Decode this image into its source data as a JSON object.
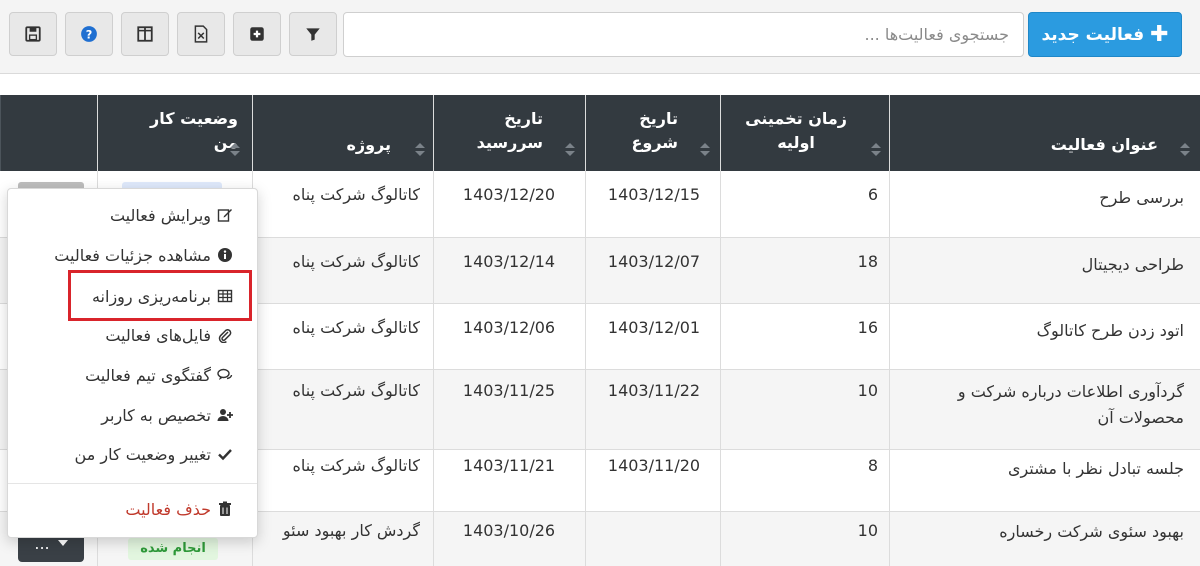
{
  "toolbar": {
    "new_activity_label": "فعالیت جدید",
    "search_placeholder": "جستجوی فعالیت‌ها ..."
  },
  "table": {
    "columns": {
      "title": "عنوان فعالیت",
      "estimate_line1": "زمان تخمینی",
      "estimate_line2": "اولیه",
      "start_line1": "تاریخ",
      "start_line2": "شروع",
      "due_line1": "تاریخ",
      "due_line2": "سررسید",
      "project": "پروژه",
      "status_line1": "وضعیت کار",
      "status_line2": "من"
    },
    "rows": [
      {
        "title": "بررسی طرح",
        "estimate": "6",
        "start": "1403/12/15",
        "due": "1403/12/20",
        "project": "کاتالوگ شرکت پناه"
      },
      {
        "title": "طراحی دیجیتال",
        "estimate": "18",
        "start": "1403/12/07",
        "due": "1403/12/14",
        "project": "کاتالوگ شرکت پناه"
      },
      {
        "title": "اتود زدن طرح کاتالوگ",
        "estimate": "16",
        "start": "1403/12/01",
        "due": "1403/12/06",
        "project": "کاتالوگ شرکت پناه"
      },
      {
        "title": "گردآوری اطلاعات درباره شرکت و محصولات آن",
        "estimate": "10",
        "start": "1403/11/22",
        "due": "1403/11/25",
        "project": "کاتالوگ شرکت پناه"
      },
      {
        "title": "جلسه تبادل نظر با مشتری",
        "estimate": "8",
        "start": "1403/11/20",
        "due": "1403/11/21",
        "project": "کاتالوگ شرکت پناه"
      },
      {
        "title": "بهبود سئوی شرکت رخساره",
        "estimate": "10",
        "start": "",
        "due": "1403/10/26",
        "project": "گردش کار بهبود سئو",
        "status": "انجام شده"
      }
    ]
  },
  "row_menu_button": "...",
  "context_menu": {
    "items": [
      {
        "label": "ویرایش فعالیت",
        "icon": "edit-icon"
      },
      {
        "label": "مشاهده جزئیات فعالیت",
        "icon": "info-icon"
      },
      {
        "label": "برنامه‌ریزی روزانه",
        "icon": "table-icon"
      },
      {
        "label": "فایل‌های فعالیت",
        "icon": "paperclip-icon"
      },
      {
        "label": "گفتگوی تیم فعالیت",
        "icon": "comments-icon"
      },
      {
        "label": "تخصیص به کاربر",
        "icon": "user-plus-icon"
      },
      {
        "label": "تغییر وضعیت کار من",
        "icon": "check-icon"
      },
      {
        "label": "حذف فعالیت",
        "icon": "trash-icon"
      }
    ]
  },
  "colors": {
    "primary_button": "#2b9be0",
    "table_header": "#333a40",
    "danger": "#c0392b",
    "highlight_box": "#d9242b",
    "done_badge": "#2e9a39"
  }
}
